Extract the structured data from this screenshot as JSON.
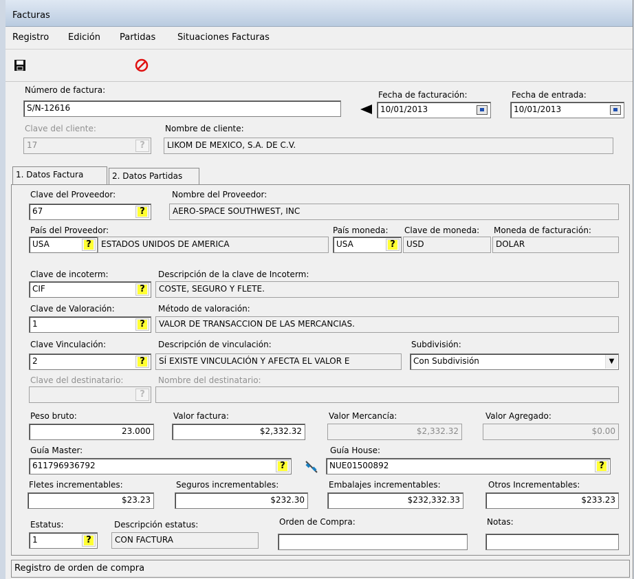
{
  "window": {
    "title": "Facturas"
  },
  "menu": [
    "Registro",
    "Edición",
    "Partidas",
    "Situaciones Facturas"
  ],
  "toolbar": {
    "save_icon": "floppy-disk-icon",
    "cancel_icon": "no-entry-icon"
  },
  "header": {
    "numero_label": "Número de factura:",
    "numero_value": "S/N-12616",
    "fecha_fact_label": "Fecha de facturación:",
    "fecha_fact_value": "10/01/2013",
    "fecha_entrada_label": "Fecha de entrada:",
    "fecha_entrada_value": "10/01/2013",
    "clave_cliente_label": "Clave del cliente:",
    "clave_cliente_value": "17",
    "nombre_cliente_label": "Nombre de cliente:",
    "nombre_cliente_value": "LIKOM DE MEXICO, S.A. DE C.V."
  },
  "tabs": [
    {
      "label": "1. Datos Factura",
      "active": true
    },
    {
      "label": "2. Datos Partidas",
      "active": false
    }
  ],
  "form": {
    "clave_proveedor_label": "Clave del Proveedor:",
    "clave_proveedor_value": "67",
    "nombre_proveedor_label": "Nombre del Proveedor:",
    "nombre_proveedor_value": "AERO-SPACE SOUTHWEST, INC",
    "pais_proveedor_label": "País del Proveedor:",
    "pais_proveedor_code": "USA",
    "pais_proveedor_name": "ESTADOS UNIDOS DE AMERICA",
    "pais_moneda_label": "País moneda:",
    "pais_moneda_value": "USA",
    "clave_moneda_label": "Clave de moneda:",
    "clave_moneda_value": "USD",
    "moneda_fact_label": "Moneda de facturación:",
    "moneda_fact_value": "DOLAR",
    "incoterm_label": "Clave de incoterm:",
    "incoterm_value": "CIF",
    "incoterm_desc_label": "Descripción de la clave de Incoterm:",
    "incoterm_desc_value": "COSTE, SEGURO Y FLETE.",
    "valoracion_label": "Clave de Valoración:",
    "valoracion_value": "1",
    "metodo_label": "Método de valoración:",
    "metodo_value": "VALOR DE TRANSACCION DE LAS MERCANCIAS.",
    "vinculacion_label": "Clave Vinculación:",
    "vinculacion_value": "2",
    "vinc_desc_label": "Descripción de vinculación:",
    "vinc_desc_value": "SÍ EXISTE VINCULACIÓN Y AFECTA EL VALOR E",
    "subdivision_label": "Subdivisión:",
    "subdivision_value": "Con Subdivisión",
    "destinatario_label": "Clave del destinatario:",
    "destinatario_value": "",
    "nombre_dest_label": "Nombre del destinatario:",
    "nombre_dest_value": "",
    "peso_label": "Peso bruto:",
    "peso_value": "23.000",
    "valor_factura_label": "Valor factura:",
    "valor_factura_value": "$2,332.32",
    "valor_mercancia_label": "Valor Mercancía:",
    "valor_mercancia_value": "$2,332.32",
    "valor_agregado_label": "Valor Agregado:",
    "valor_agregado_value": "$0.00",
    "guia_master_label": "Guía Master:",
    "guia_master_value": "611796936792",
    "guia_house_label": "Guía House:",
    "guia_house_value": "NUE01500892",
    "fletes_label": "Fletes incrementables:",
    "fletes_value": "$23.23",
    "seguros_label": "Seguros incrementables:",
    "seguros_value": "$232.30",
    "embalajes_label": "Embalajes incrementables:",
    "embalajes_value": "$232,332.33",
    "otros_label": "Otros Incrementables:",
    "otros_value": "$233.23",
    "estatus_label": "Estatus:",
    "estatus_value": "1",
    "desc_estatus_label": "Descripción estatus:",
    "desc_estatus_value": "CON FACTURA",
    "orden_label": "Orden de Compra:",
    "orden_value": "",
    "notas_label": "Notas:",
    "notas_value": ""
  },
  "status": {
    "text": "Registro de orden de compra"
  }
}
